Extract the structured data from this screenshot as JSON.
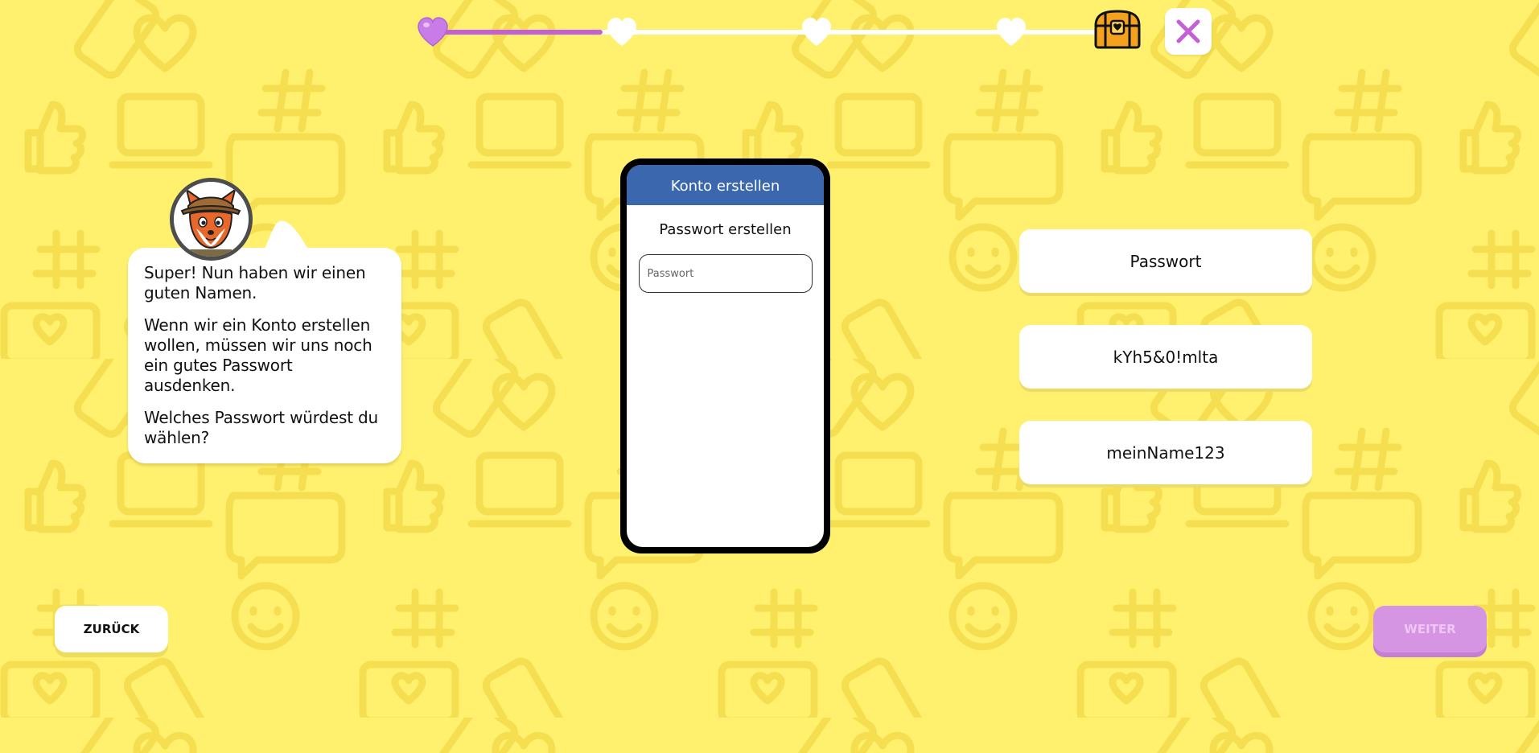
{
  "progress": {
    "current_step": 1,
    "total_steps": 5,
    "fill_fraction": 0.25
  },
  "colors": {
    "background": "#fff06e",
    "accent_purple": "#c55fd8",
    "phone_header": "#3a67ae",
    "next_button": "#d595e3"
  },
  "close": {
    "icon": "close-icon"
  },
  "mascot": {
    "icon": "fox-avatar"
  },
  "bubble": {
    "p1": "Super! Nun haben wir einen guten Namen.",
    "p2": "Wenn wir ein Konto erstellen wollen, müssen wir uns noch ein gutes Passwort ausdenken.",
    "p3": "Welches Passwort würdest du wählen?"
  },
  "phone": {
    "header": "Konto erstellen",
    "subtitle": "Passwort erstellen",
    "input": {
      "placeholder": "Passwort",
      "value": ""
    }
  },
  "options": [
    "Passwort",
    "kYh5&0!mlta",
    "meinName123"
  ],
  "nav": {
    "back_label": "ZURÜCK",
    "next_label": "WEITER"
  }
}
